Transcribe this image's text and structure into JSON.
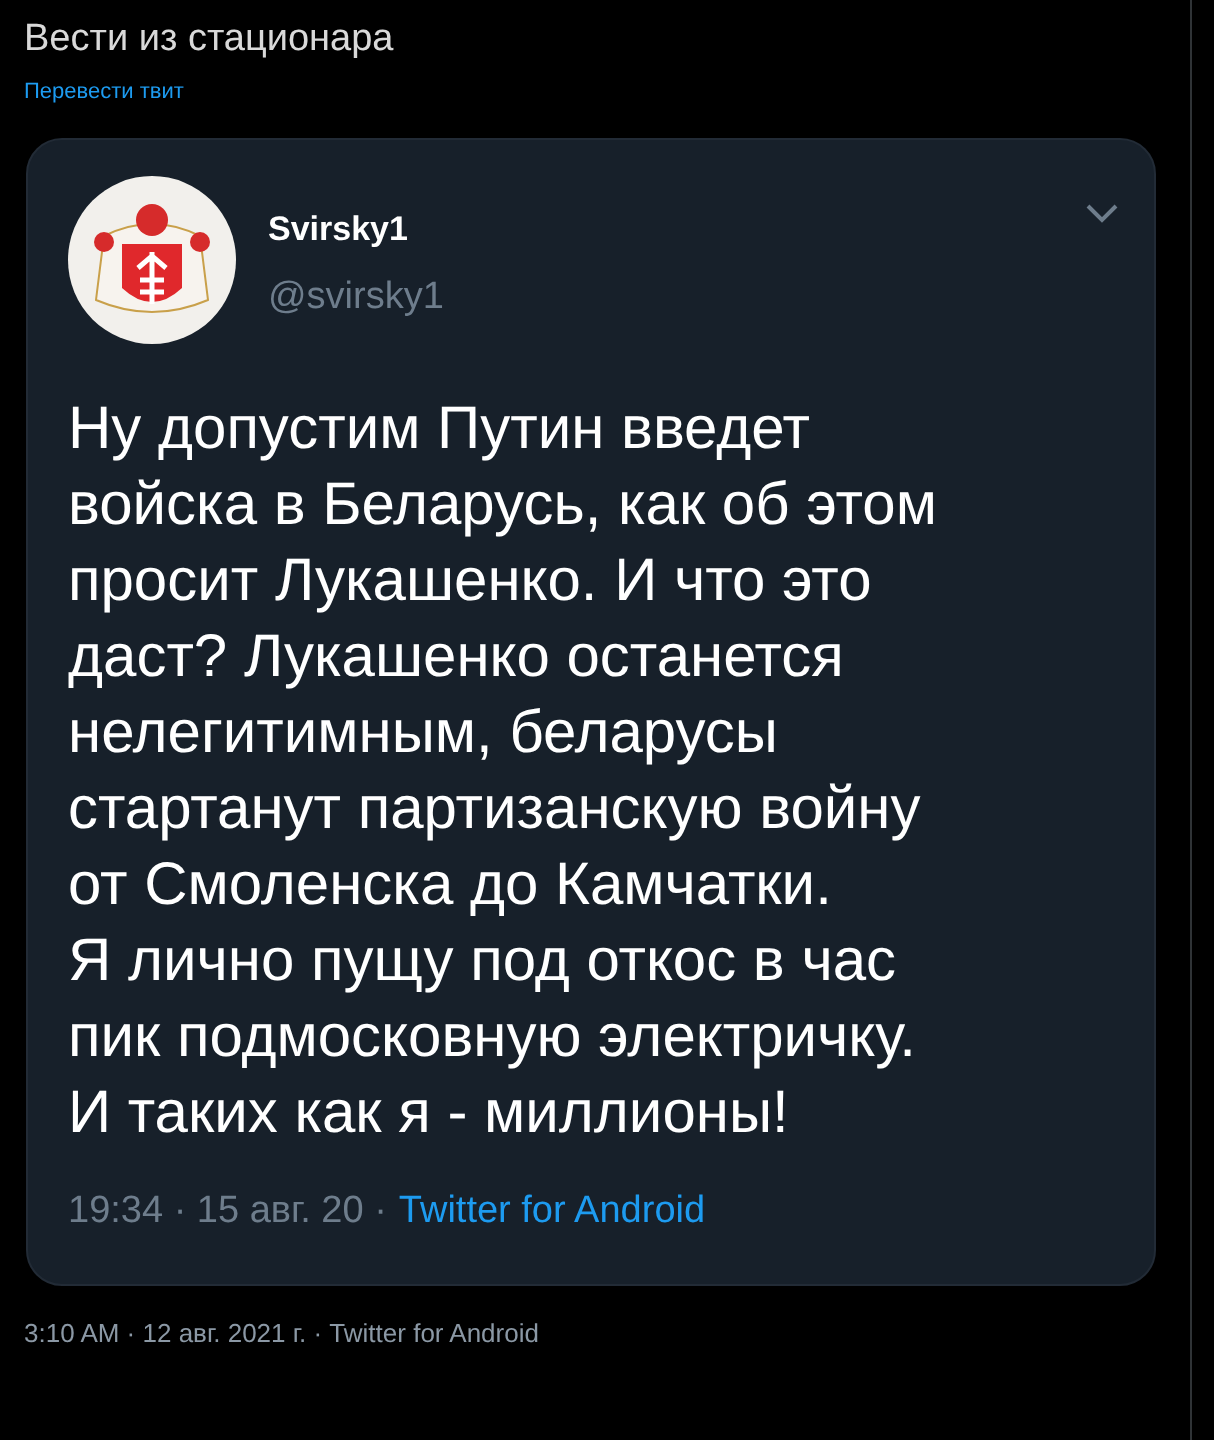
{
  "tweet_text": "Вести из стационара",
  "translate_link": "Перевести твит",
  "quoted_tweet": {
    "display_name": "Svirsky1",
    "handle": "@svirsky1",
    "lines": [
      "Ну допустим Путин введет",
      "войска в Беларусь, как об этом",
      "просит Лукашенко. И что это",
      "даст? Лукашенко останется",
      "нелегитимным, беларусы",
      "стартанут партизанскую войну",
      "от Смоленска до Камчатки.",
      "Я лично пущу под откос в час",
      "пик подмосковную электричку.",
      "И таких как я - миллионы!"
    ],
    "timestamp": "19:34 · 15 авг. 20 ·",
    "source": "Twitter for Android"
  },
  "footer": "3:10 AM · 12 авг. 2021 г. · Twitter for Android"
}
